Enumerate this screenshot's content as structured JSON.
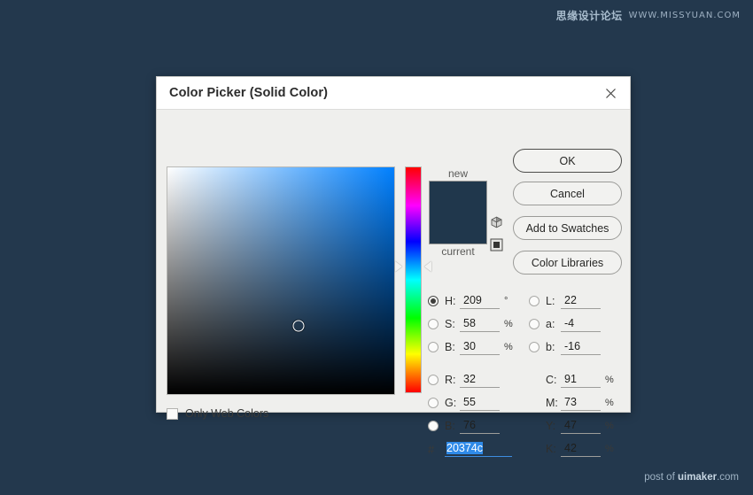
{
  "watermarks": {
    "top_cn": "思缘设计论坛",
    "top_en": "WWW.MISSYUAN.COM",
    "bottom_prefix": "post of ",
    "bottom_brand": "uimaker",
    "bottom_suffix": ".com"
  },
  "dialog": {
    "title": "Color Picker (Solid Color)",
    "close_icon": "close-icon"
  },
  "preview": {
    "new_label": "new",
    "current_label": "current",
    "new_color": "#20374c",
    "current_color": "#20374c",
    "gamut_warning_icon": "cube-icon",
    "web_safe_icon": "square-icon"
  },
  "picker": {
    "hue_color": "#0080ff",
    "cursor_x_pct": 58,
    "cursor_y_pct": 70,
    "hue_marker_pct": 44
  },
  "web_colors": {
    "label": "Only Web Colors",
    "checked": false
  },
  "buttons": {
    "ok": "OK",
    "cancel": "Cancel",
    "add_to_swatches": "Add to Swatches",
    "color_libraries": "Color Libraries"
  },
  "fields": {
    "hsb": [
      {
        "label": "H:",
        "value": "209",
        "unit": "°",
        "selected": true
      },
      {
        "label": "S:",
        "value": "58",
        "unit": "%",
        "selected": false
      },
      {
        "label": "B:",
        "value": "30",
        "unit": "%",
        "selected": false
      }
    ],
    "lab": [
      {
        "label": "L:",
        "value": "22",
        "unit": "",
        "selected": false
      },
      {
        "label": "a:",
        "value": "-4",
        "unit": "",
        "selected": false
      },
      {
        "label": "b:",
        "value": "-16",
        "unit": "",
        "selected": false
      }
    ],
    "rgb": [
      {
        "label": "R:",
        "value": "32",
        "unit": "",
        "selected": false
      },
      {
        "label": "G:",
        "value": "55",
        "unit": "",
        "selected": false
      },
      {
        "label": "B:",
        "value": "76",
        "unit": "",
        "selected": false
      }
    ],
    "cmyk": [
      {
        "label": "C:",
        "value": "91",
        "unit": "%"
      },
      {
        "label": "M:",
        "value": "73",
        "unit": "%"
      },
      {
        "label": "Y:",
        "value": "47",
        "unit": "%"
      },
      {
        "label": "K:",
        "value": "42",
        "unit": "%"
      }
    ],
    "hex_symbol": "#",
    "hex_value": "20374c"
  }
}
